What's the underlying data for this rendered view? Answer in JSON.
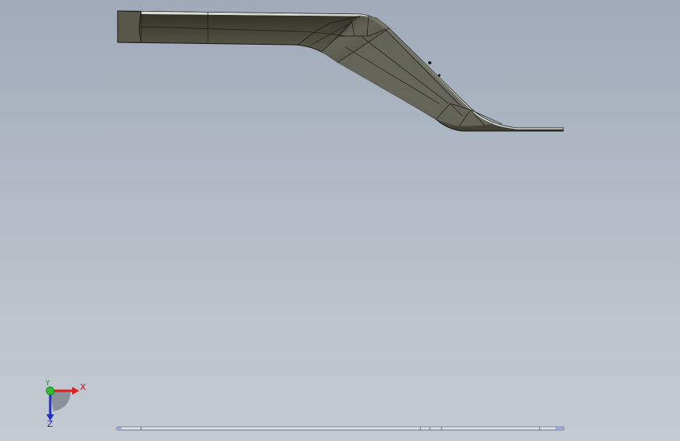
{
  "viewport": {
    "background_top": "#a0aab9",
    "background_bottom": "#c4cad2",
    "part_color": "#4a4a3c",
    "part_highlight": "#6f705e",
    "edge_color": "#1a1a1a"
  },
  "triad": {
    "x_label": "X",
    "y_label": "Y",
    "z_label": "Z",
    "x_color": "#e0201e",
    "y_color": "#2fbf2f",
    "z_color": "#2030c0"
  }
}
